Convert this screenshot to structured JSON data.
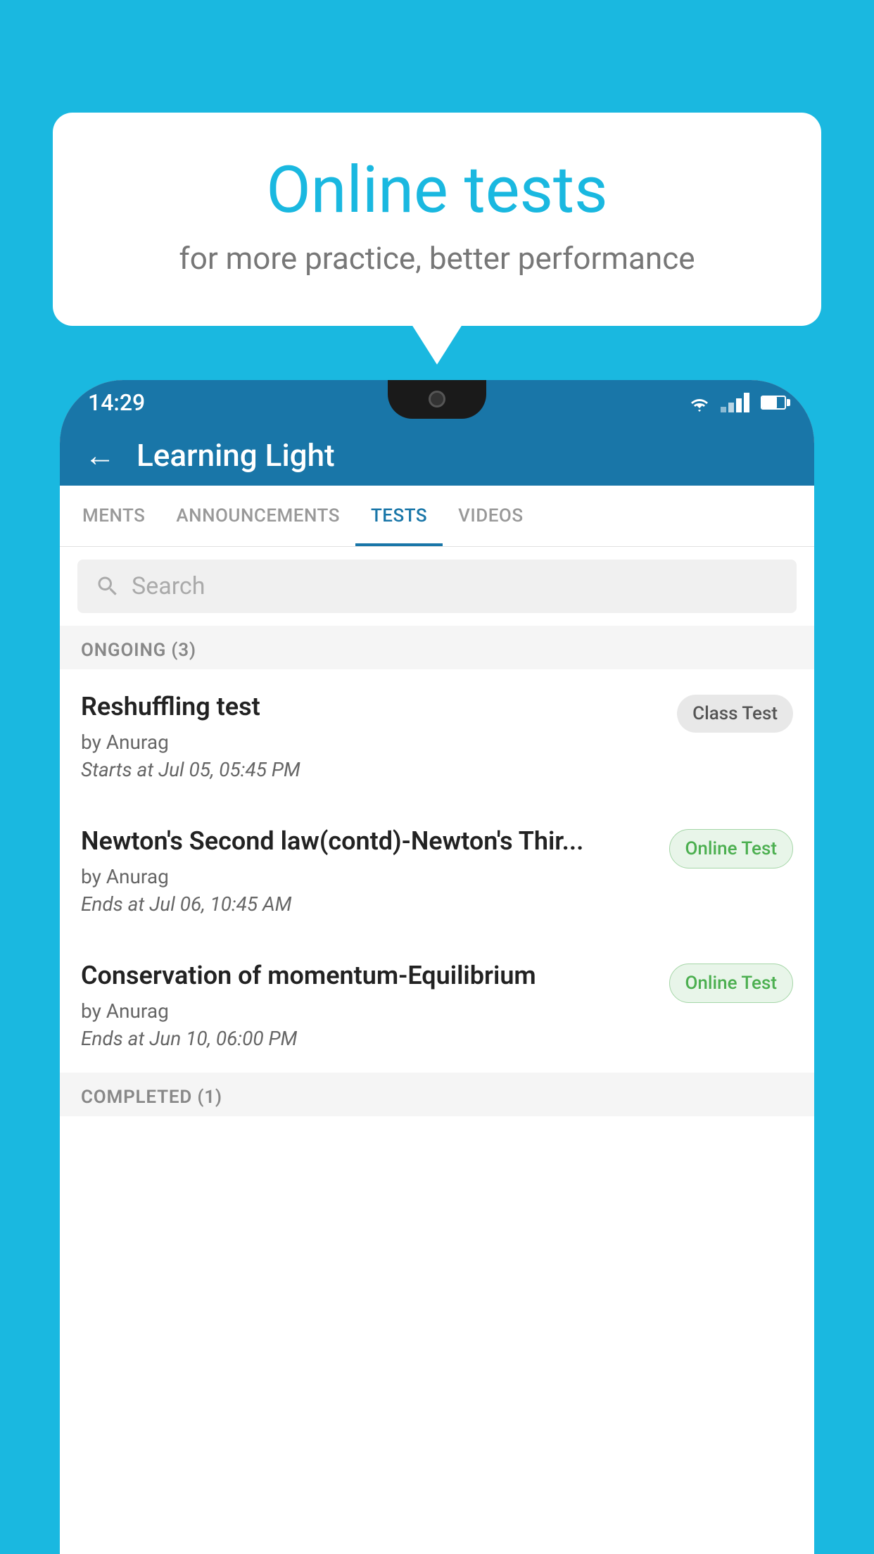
{
  "background_color": "#1ab8e0",
  "bubble": {
    "title": "Online tests",
    "subtitle": "for more practice, better performance"
  },
  "status_bar": {
    "time": "14:29"
  },
  "app_bar": {
    "title": "Learning Light",
    "back_label": "←"
  },
  "tabs": [
    {
      "label": "MENTS",
      "active": false
    },
    {
      "label": "ANNOUNCEMENTS",
      "active": false
    },
    {
      "label": "TESTS",
      "active": true
    },
    {
      "label": "VIDEOS",
      "active": false
    }
  ],
  "search": {
    "placeholder": "Search"
  },
  "ongoing_section": {
    "label": "ONGOING (3)"
  },
  "tests": [
    {
      "name": "Reshuffling test",
      "by": "by Anurag",
      "time_label": "Starts at",
      "time_value": "Jul 05, 05:45 PM",
      "badge": "Class Test",
      "badge_type": "class"
    },
    {
      "name": "Newton's Second law(contd)-Newton's Thir...",
      "by": "by Anurag",
      "time_label": "Ends at",
      "time_value": "Jul 06, 10:45 AM",
      "badge": "Online Test",
      "badge_type": "online"
    },
    {
      "name": "Conservation of momentum-Equilibrium",
      "by": "by Anurag",
      "time_label": "Ends at",
      "time_value": "Jun 10, 06:00 PM",
      "badge": "Online Test",
      "badge_type": "online"
    }
  ],
  "completed_section": {
    "label": "COMPLETED (1)"
  }
}
